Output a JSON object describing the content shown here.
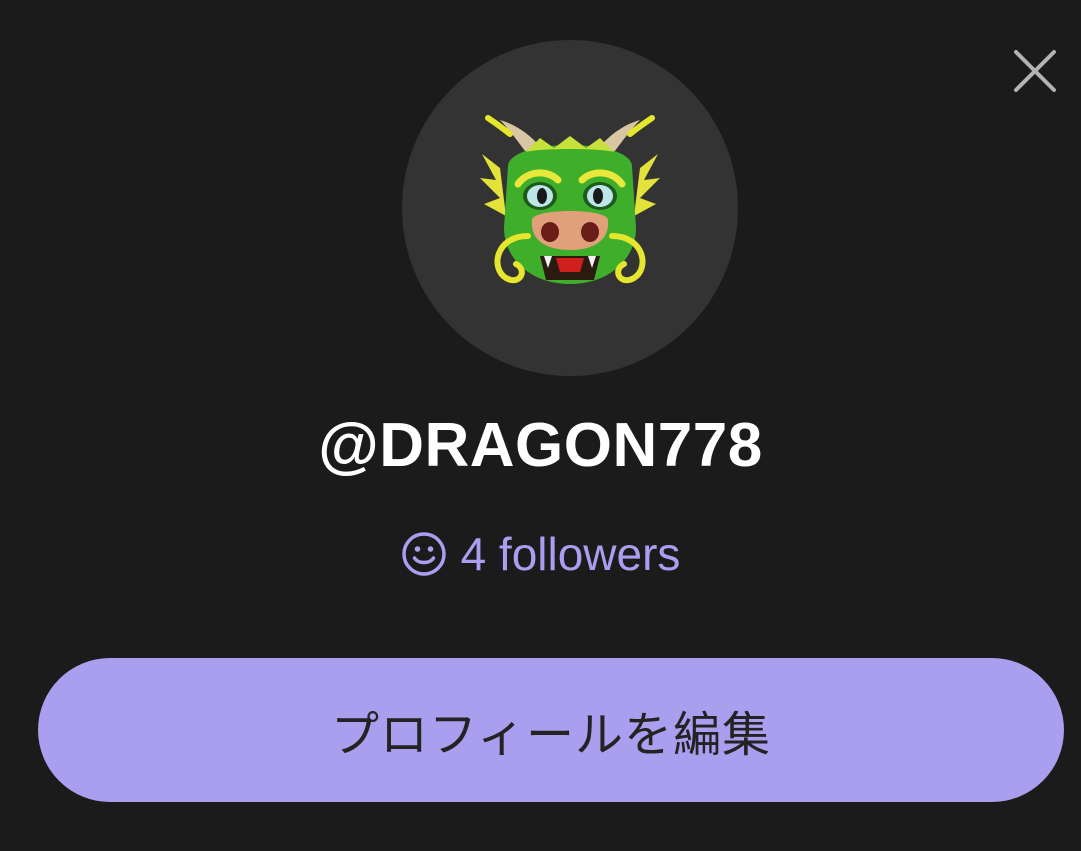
{
  "close_button": {
    "icon": "close-icon",
    "color": "#b3b3b3"
  },
  "avatar": {
    "icon": "dragon-face-icon",
    "background": "#333333"
  },
  "profile": {
    "username": "@DRAGON778"
  },
  "followers": {
    "icon": "smiley-icon",
    "label": "4 followers",
    "color": "#a99ef0"
  },
  "edit_button": {
    "label": "プロフィールを編集",
    "background": "#aa9fef"
  }
}
